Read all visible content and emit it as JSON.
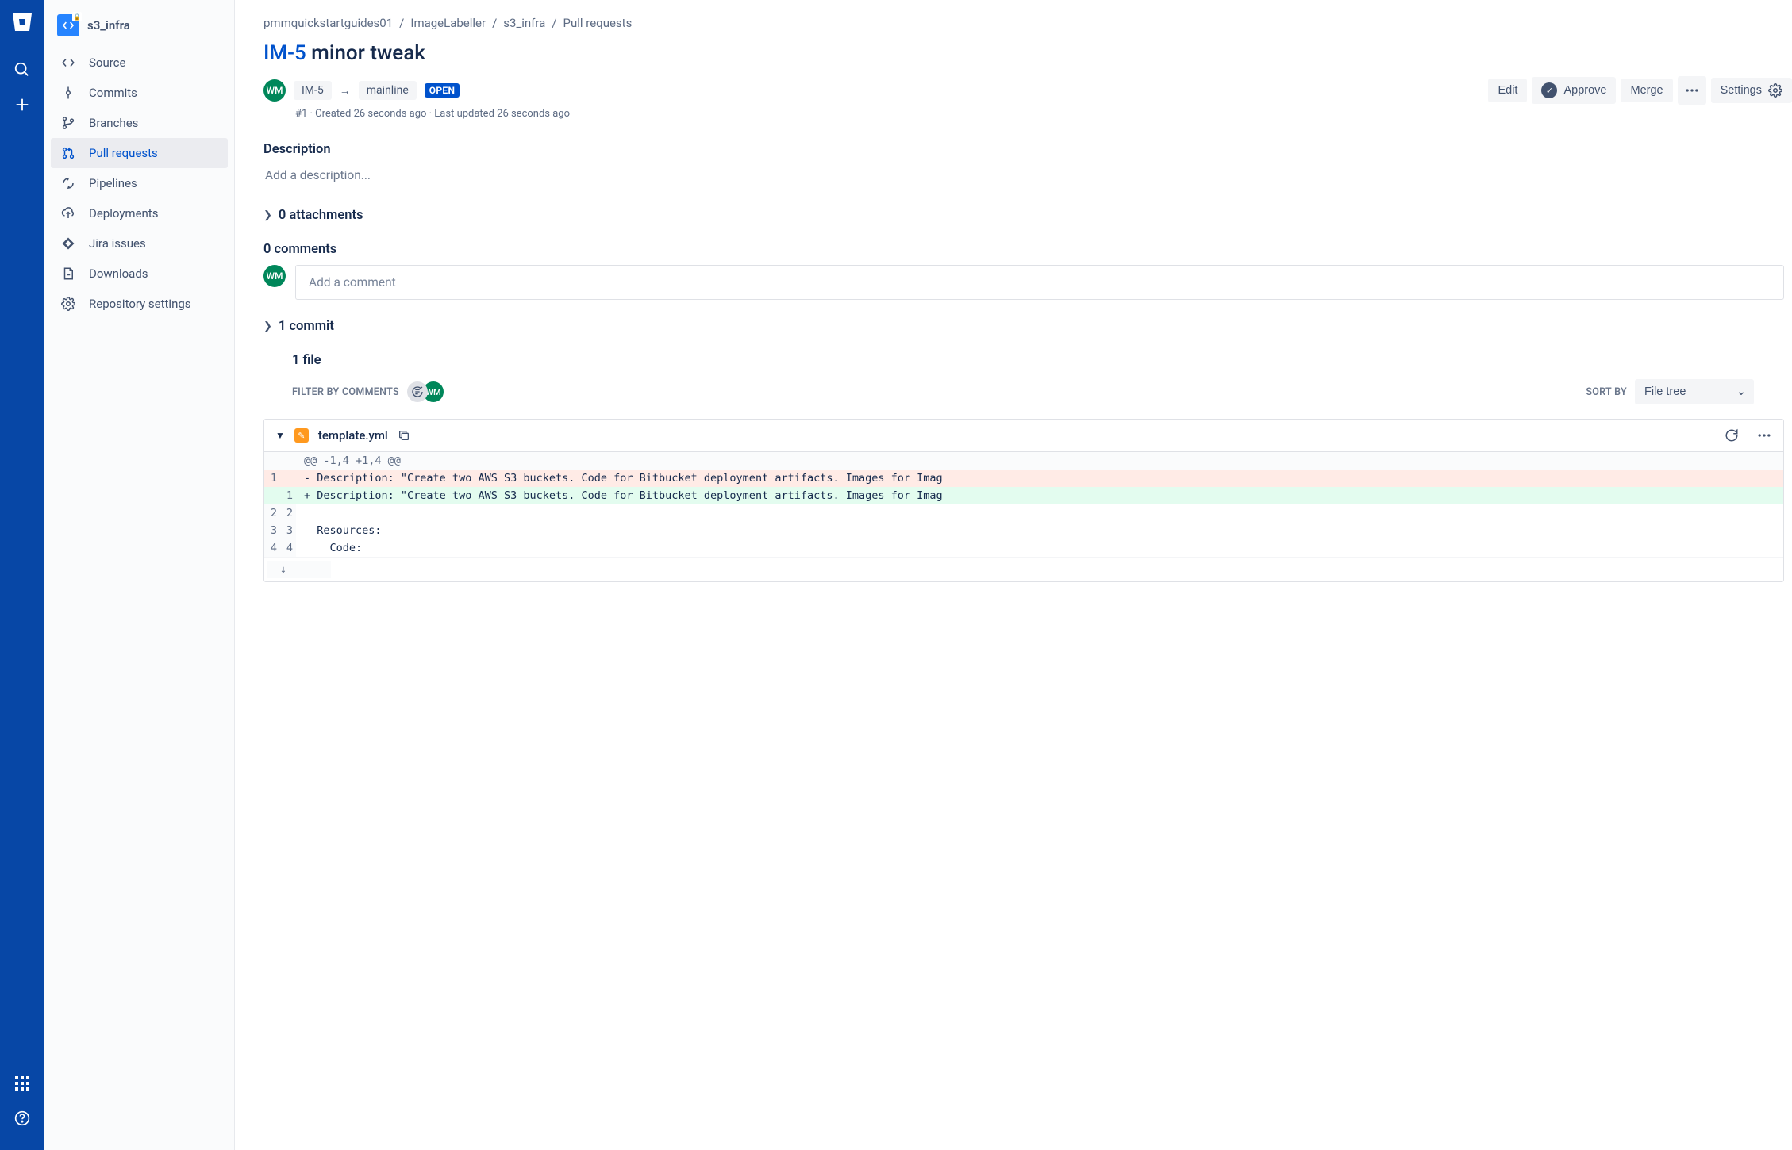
{
  "project": {
    "name": "s3_infra"
  },
  "sidebar": {
    "items": [
      {
        "label": "Source"
      },
      {
        "label": "Commits"
      },
      {
        "label": "Branches"
      },
      {
        "label": "Pull requests"
      },
      {
        "label": "Pipelines"
      },
      {
        "label": "Deployments"
      },
      {
        "label": "Jira issues"
      },
      {
        "label": "Downloads"
      },
      {
        "label": "Repository settings"
      }
    ]
  },
  "breadcrumbs": {
    "workspace": "pmmquickstartguides01",
    "project": "ImageLabeller",
    "repo": "s3_infra",
    "section": "Pull requests"
  },
  "pr": {
    "issue": "IM-5",
    "title_rest": " minor tweak",
    "source_branch": "IM-5",
    "target_branch": "mainline",
    "state": "OPEN",
    "author_initials": "WM",
    "meta": "#1 · Created 26 seconds ago · Last updated 26 seconds ago"
  },
  "actions": {
    "edit": "Edit",
    "approve": "Approve",
    "merge": "Merge",
    "settings": "Settings"
  },
  "sections": {
    "description": "Description",
    "desc_placeholder": "Add a description...",
    "attachments": "0 attachments",
    "comments": "0 comments",
    "comment_placeholder": "Add a comment",
    "commits": "1 commit",
    "files": "1 file",
    "filter_label": "FILTER BY COMMENTS",
    "sort_label": "SORT BY",
    "sort_value": "File tree"
  },
  "file": {
    "name": "template.yml",
    "hunk": "@@ -1,4 +1,4 @@",
    "lines": [
      {
        "old": "1",
        "new": "",
        "type": "del",
        "text": "- Description: \"Create two AWS S3 buckets. Code for Bitbucket deployment artifacts. Images for Imag"
      },
      {
        "old": "",
        "new": "1",
        "type": "add",
        "text": "+ Description: \"Create two AWS S3 buckets. Code for Bitbucket deployment artifacts. Images for Imag"
      },
      {
        "old": "2",
        "new": "2",
        "type": "ctx",
        "text": "  "
      },
      {
        "old": "3",
        "new": "3",
        "type": "ctx",
        "text": "  Resources:"
      },
      {
        "old": "4",
        "new": "4",
        "type": "ctx",
        "text": "    Code:"
      }
    ]
  }
}
